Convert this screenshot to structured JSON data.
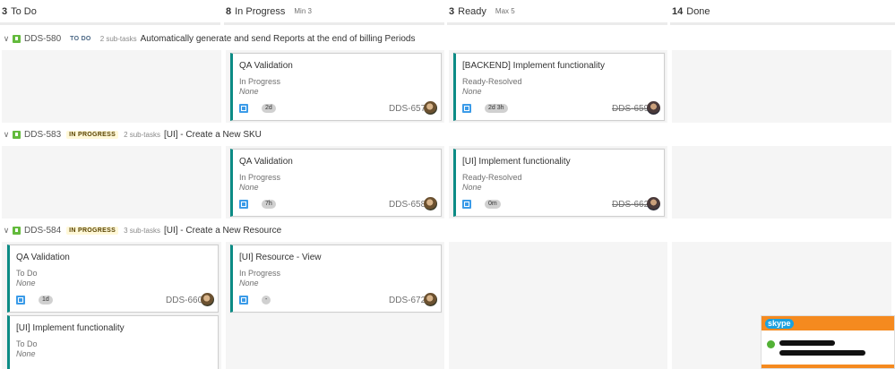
{
  "columns": [
    {
      "count": "3",
      "name": "To Do",
      "limit": ""
    },
    {
      "count": "8",
      "name": "In Progress",
      "limit": "Min 3"
    },
    {
      "count": "3",
      "name": "Ready",
      "limit": "Max 5"
    },
    {
      "count": "14",
      "name": "Done",
      "limit": ""
    }
  ],
  "lanes": [
    {
      "key": "DDS-580",
      "status": "TO DO",
      "subtasks": "2 sub-tasks",
      "summary": "Automatically generate and send Reports at the end of billing Periods"
    },
    {
      "key": "DDS-583",
      "status": "IN PROGRESS",
      "subtasks": "2 sub-tasks",
      "summary": "[UI] - Create a New SKU"
    },
    {
      "key": "DDS-584",
      "status": "IN PROGRESS",
      "subtasks": "3 sub-tasks",
      "summary": "[UI] - Create a New Resource"
    }
  ],
  "cards": [
    {
      "title": "QA Validation",
      "status": "In Progress",
      "assignee": "None",
      "time": "2d",
      "key": "DDS-657"
    },
    {
      "title": "[BACKEND] Implement functionality",
      "status": "Ready-Resolved",
      "assignee": "None",
      "time": "2d 3h",
      "key": "DDS-659"
    },
    {
      "title": "QA Validation",
      "status": "In Progress",
      "assignee": "None",
      "time": "7h",
      "key": "DDS-658"
    },
    {
      "title": "[UI] Implement functionality",
      "status": "Ready-Resolved",
      "assignee": "None",
      "time": "0m",
      "key": "DDS-662"
    },
    {
      "title": "QA Validation",
      "status": "To Do",
      "assignee": "None",
      "time": "1d",
      "key": "DDS-660"
    },
    {
      "title": "[UI] Resource - View",
      "status": "In Progress",
      "assignee": "None",
      "time": "-",
      "key": "DDS-672"
    },
    {
      "title": "[UI] Implement functionality",
      "status": "To Do",
      "assignee": "None",
      "time": "",
      "key": ""
    }
  ],
  "popup": {
    "app": "skype"
  },
  "colors": {
    "accent": "#0c8b85",
    "story": "#63ba3c",
    "subtask": "#3b9be8",
    "skype_bar": "#f58a1f"
  }
}
